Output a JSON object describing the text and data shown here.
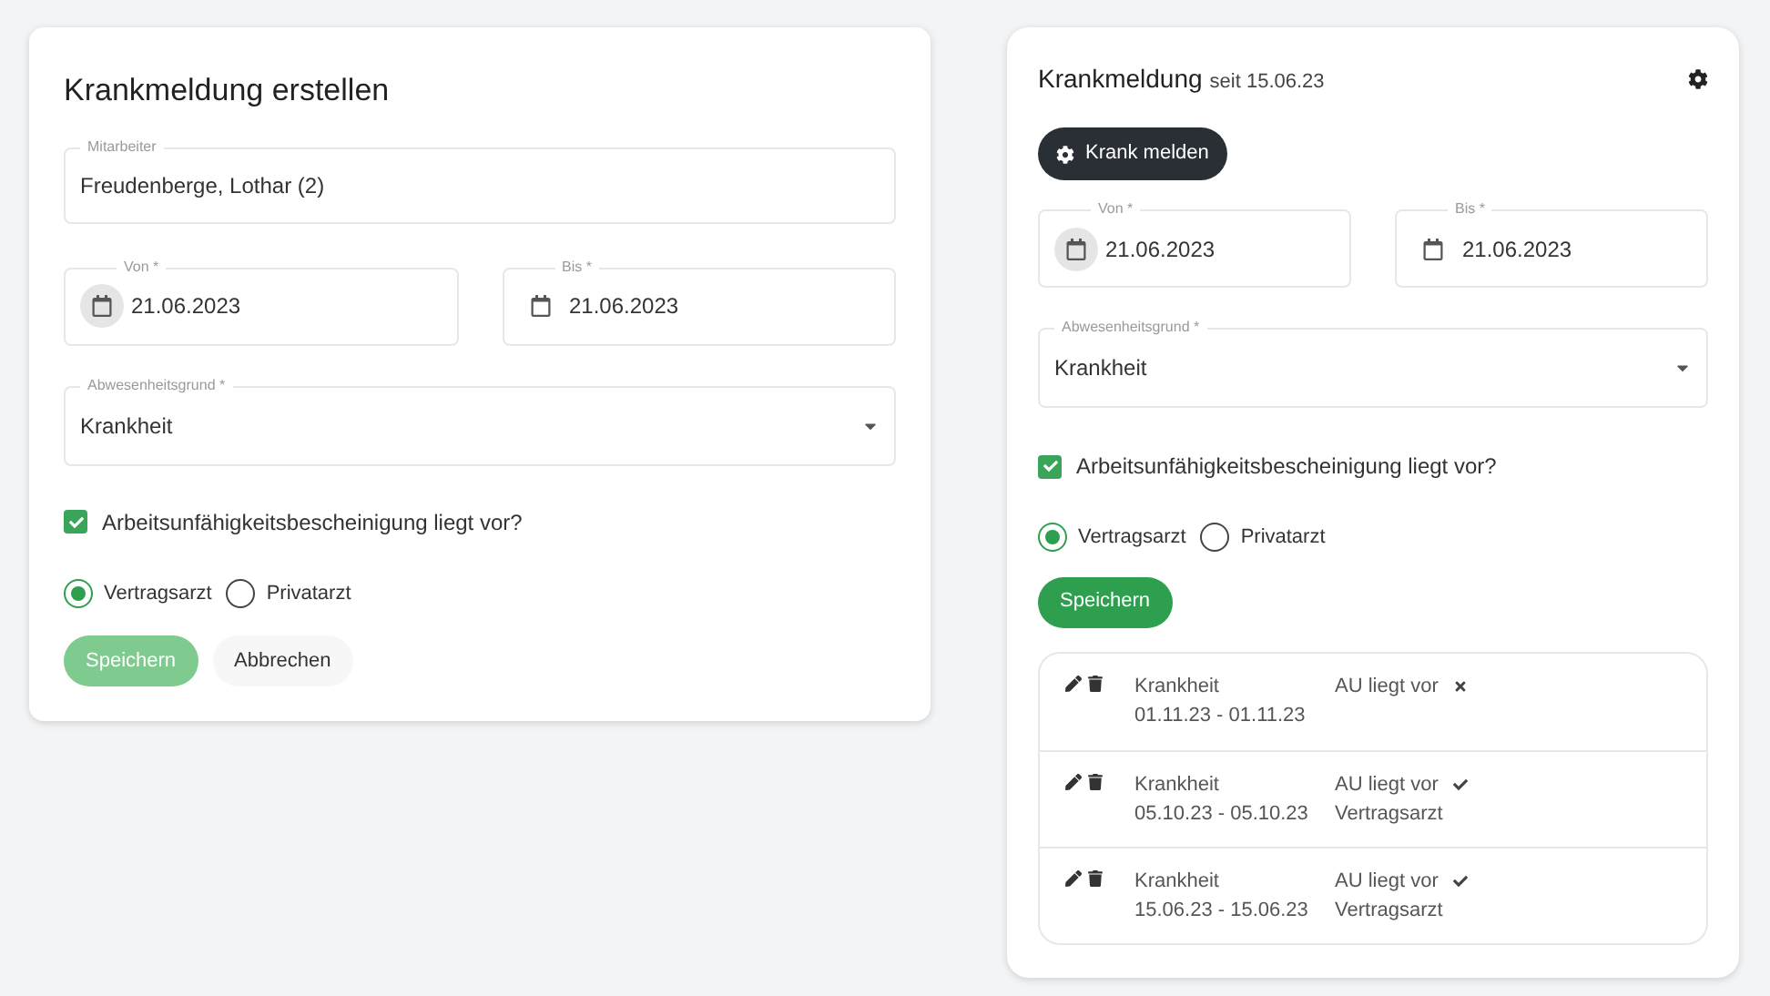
{
  "create_form": {
    "title": "Krankmeldung erstellen",
    "employee": {
      "label": "Mitarbeiter",
      "value": "Freudenberge, Lothar (2)"
    },
    "from": {
      "label": "Von *",
      "value": "21.06.2023"
    },
    "to": {
      "label": "Bis *",
      "value": "21.06.2023"
    },
    "reason": {
      "label": "Abwesenheitsgrund *",
      "value": "Krankheit"
    },
    "certificate": {
      "label": "Arbeitsunfähigkeitsbescheinigung liegt vor?",
      "checked": true
    },
    "doctor_options": [
      {
        "label": "Vertragsarzt",
        "selected": true
      },
      {
        "label": "Privatarzt",
        "selected": false
      }
    ],
    "save": {
      "label": "Speichern",
      "disabled": true
    },
    "cancel": {
      "label": "Abbrechen"
    }
  },
  "overview": {
    "title": "Krankmeldung",
    "subtitle": "seit 15.06.23",
    "report_button": "Krank melden",
    "from": {
      "label": "Von *",
      "value": "21.06.2023"
    },
    "to": {
      "label": "Bis *",
      "value": "21.06.2023"
    },
    "reason": {
      "label": "Abwesenheitsgrund *",
      "value": "Krankheit"
    },
    "certificate": {
      "label": "Arbeitsunfähigkeitsbescheinigung liegt vor?",
      "checked": true
    },
    "doctor_options": [
      {
        "label": "Vertragsarzt",
        "selected": true
      },
      {
        "label": "Privatarzt",
        "selected": false
      }
    ],
    "save": {
      "label": "Speichern",
      "disabled": false
    },
    "entries": [
      {
        "reason": "Krankheit",
        "period": "01.11.23 - 01.11.23",
        "au_label": "AU liegt vor",
        "au": false
      },
      {
        "reason": "Krankheit",
        "period": "05.10.23 - 05.10.23",
        "au_label": "AU liegt vor",
        "au": true,
        "doctor": "Vertragsarzt"
      },
      {
        "reason": "Krankheit",
        "period": "15.06.23 - 15.06.23",
        "au_label": "AU liegt vor",
        "au": true,
        "doctor": "Vertragsarzt"
      }
    ]
  }
}
